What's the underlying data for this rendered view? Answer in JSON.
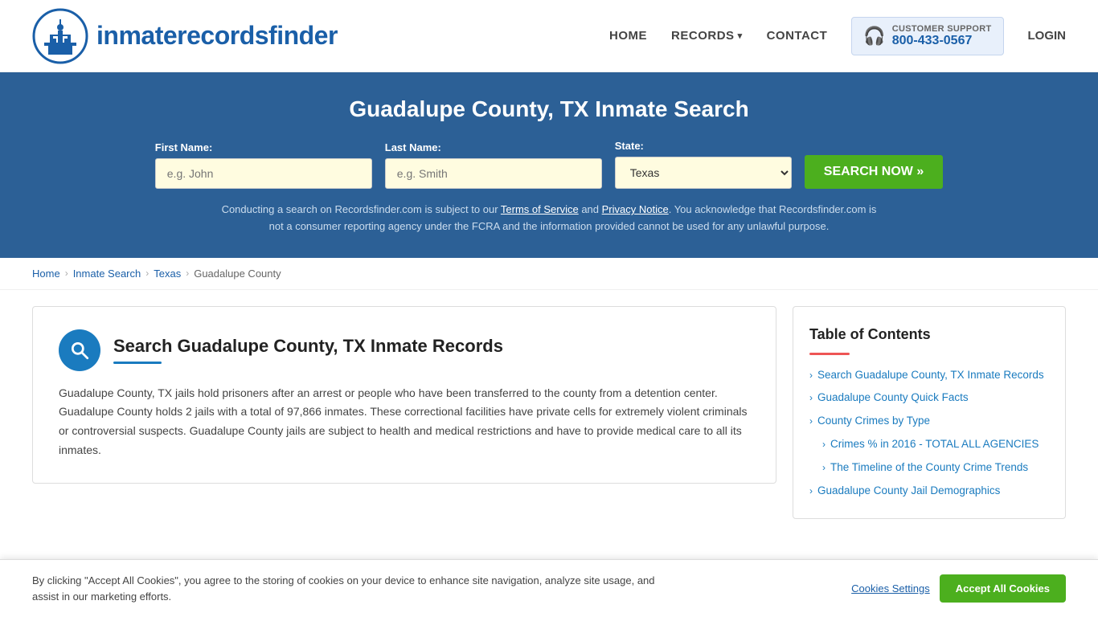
{
  "header": {
    "logo_text_normal": "inmaterecords",
    "logo_text_bold": "finder",
    "nav": {
      "home": "HOME",
      "records": "RECORDS",
      "contact": "CONTACT",
      "login": "LOGIN"
    },
    "support": {
      "label": "CUSTOMER SUPPORT",
      "phone": "800-433-0567"
    }
  },
  "hero": {
    "title": "Guadalupe County, TX Inmate Search",
    "form": {
      "first_name_label": "First Name:",
      "first_name_placeholder": "e.g. John",
      "last_name_label": "Last Name:",
      "last_name_placeholder": "e.g. Smith",
      "state_label": "State:",
      "state_value": "Texas",
      "search_button": "SEARCH NOW »"
    },
    "disclaimer": "Conducting a search on Recordsfinder.com is subject to our Terms of Service and Privacy Notice. You acknowledge that Recordsfinder.com is not a consumer reporting agency under the FCRA and the information provided cannot be used for any unlawful purpose."
  },
  "breadcrumb": {
    "items": [
      "Home",
      "Inmate Search",
      "Texas",
      "Guadalupe County"
    ]
  },
  "main": {
    "section_title": "Search Guadalupe County, TX Inmate Records",
    "section_body": "Guadalupe County, TX jails hold prisoners after an arrest or people who have been transferred to the county from a detention center. Guadalupe County holds 2 jails with a total of 97,866 inmates. These correctional facilities have private cells for extremely violent criminals or controversial suspects. Guadalupe County jails are subject to health and medical restrictions and have to provide medical care to all its inmates."
  },
  "toc": {
    "title": "Table of Contents",
    "items": [
      {
        "label": "Search Guadalupe County, TX Inmate Records",
        "sub": false
      },
      {
        "label": "Guadalupe County Quick Facts",
        "sub": false
      },
      {
        "label": "County Crimes by Type",
        "sub": false
      },
      {
        "label": "Crimes % in 2016 - TOTAL ALL AGENCIES",
        "sub": true
      },
      {
        "label": "The Timeline of the County Crime Trends",
        "sub": true
      },
      {
        "label": "Guadalupe County Jail Demographics",
        "sub": false
      }
    ]
  },
  "cookie": {
    "text": "By clicking \"Accept All Cookies\", you agree to the storing of cookies on your device to enhance site navigation, analyze site usage, and assist in our marketing efforts.",
    "settings_label": "Cookies Settings",
    "accept_label": "Accept All Cookies"
  }
}
